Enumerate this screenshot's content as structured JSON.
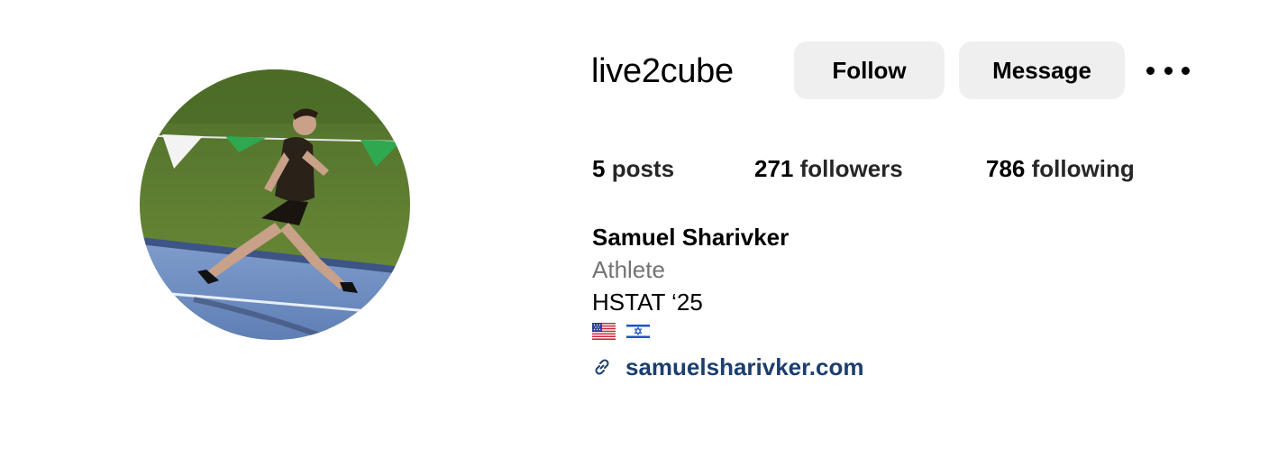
{
  "profile": {
    "username": "live2cube",
    "follow_label": "Follow",
    "message_label": "Message",
    "more_icon": "more-horizontal-icon",
    "stats": {
      "posts_count": "5",
      "posts_label": "posts",
      "followers_count": "271",
      "followers_label": "followers",
      "following_count": "786",
      "following_label": "following"
    },
    "full_name": "Samuel Sharivker",
    "category": "Athlete",
    "bio_line": "HSTAT ‘25",
    "flags": [
      "us-flag-icon",
      "israel-flag-icon"
    ],
    "link_icon": "link-icon",
    "link_text": "samuelsharivker.com"
  },
  "colors": {
    "button_bg": "#efefef",
    "category_text": "#737373",
    "link_text": "#1c3e6e"
  }
}
